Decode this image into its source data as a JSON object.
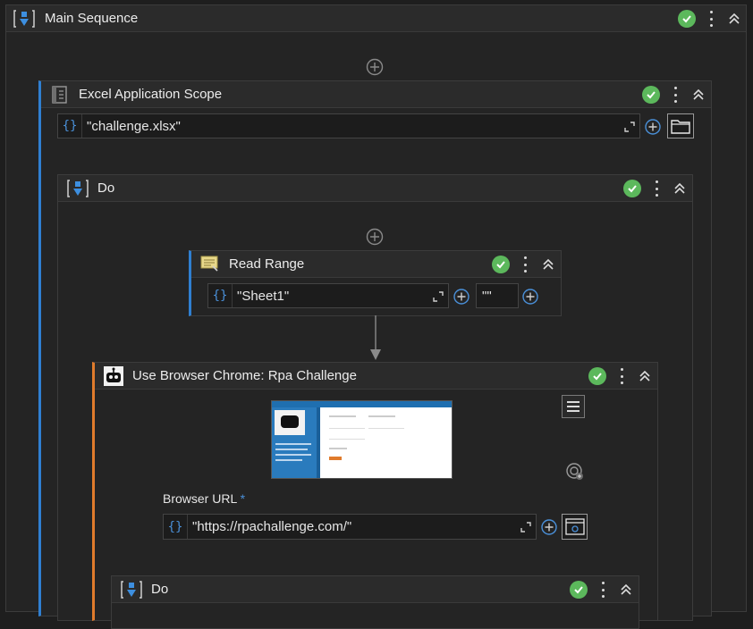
{
  "main_sequence": {
    "title": "Main Sequence"
  },
  "excel_scope": {
    "title": "Excel Application Scope",
    "file_value": "\"challenge.xlsx\""
  },
  "do_outer": {
    "title": "Do"
  },
  "read_range": {
    "title": "Read Range",
    "sheet_value": "\"Sheet1\"",
    "range_value": "\"\""
  },
  "use_browser": {
    "title": "Use Browser Chrome: Rpa Challenge",
    "url_label": "Browser URL",
    "required_marker": "*",
    "url_value": "\"https://rpachallenge.com/\""
  },
  "do_inner": {
    "title": "Do"
  },
  "colors": {
    "background": "#1e1e1e",
    "header": "#2b2b2b",
    "check_green": "#5cb85c",
    "excel_accent": "#2f7fd1",
    "browser_accent": "#e07b2c",
    "brace_blue": "#4a90d9"
  }
}
